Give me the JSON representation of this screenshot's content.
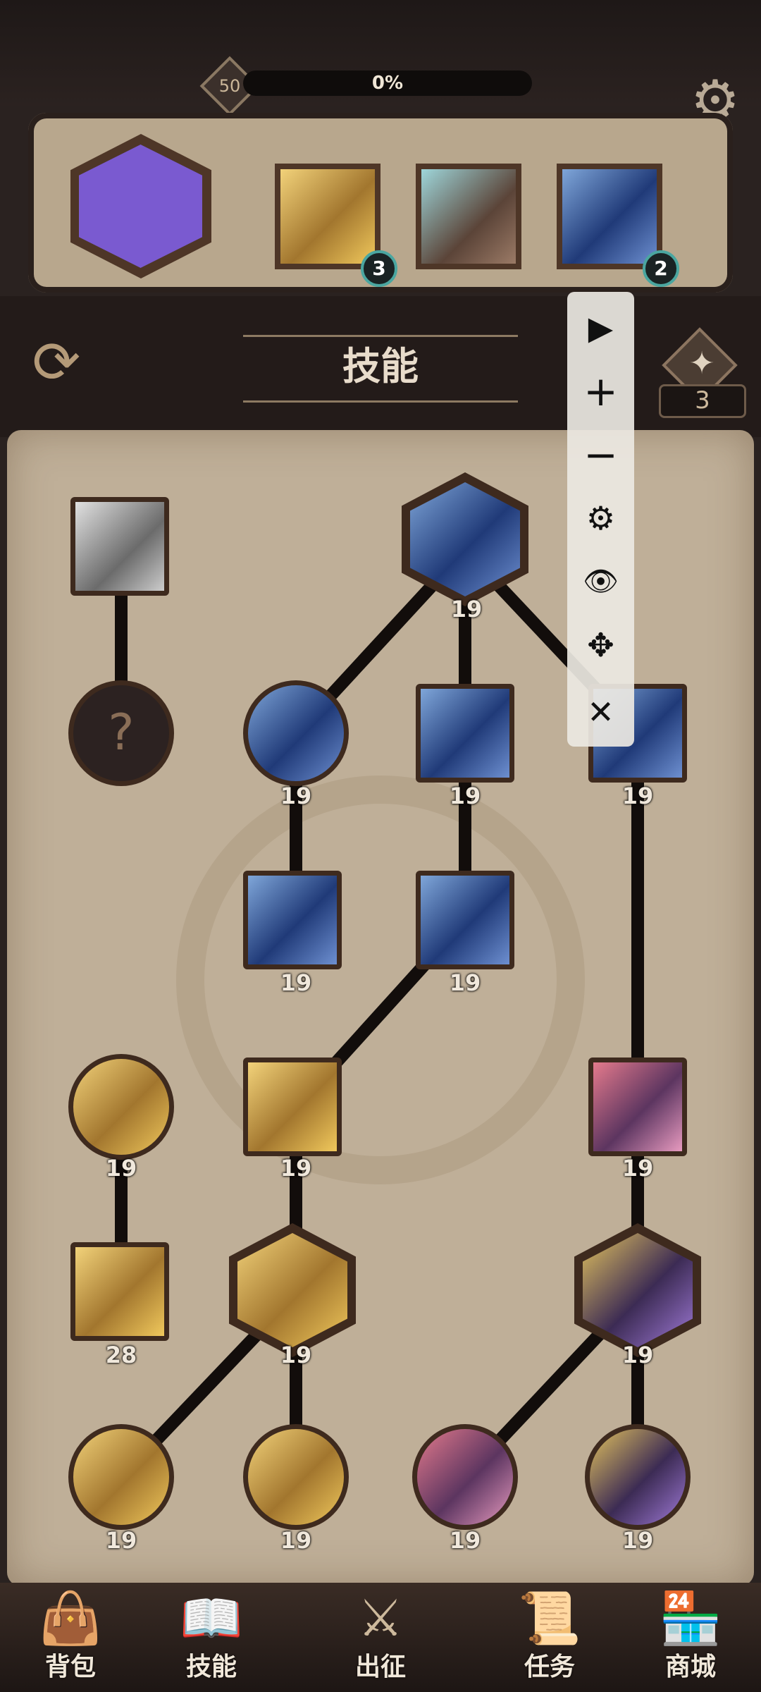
{
  "top_status": {
    "level": "50",
    "progress_text": "0%",
    "progress_fraction": 0.0,
    "settings_icon": "gear-icon"
  },
  "equipped_skills": [
    {
      "name_icon": "purple-crystal-skill-icon",
      "badge": ""
    },
    {
      "name_icon": "golden-blade-skill-icon",
      "badge": "3"
    },
    {
      "name_icon": "ice-rock-skill-icon",
      "badge": ""
    },
    {
      "name_icon": "ice-shard-skill-icon",
      "badge": "2"
    }
  ],
  "header": {
    "title": "技能",
    "skill_points": "3",
    "refresh_icon": "refresh-icon",
    "points_icon": "star-diamond-icon"
  },
  "control_panel": {
    "items": [
      {
        "icon": "play-icon",
        "glyph": "▶"
      },
      {
        "icon": "plus-icon",
        "glyph": "+"
      },
      {
        "icon": "minus-icon",
        "glyph": "−"
      },
      {
        "icon": "gear-icon",
        "glyph": "⚙"
      },
      {
        "icon": "eye-icon",
        "glyph": "👁"
      },
      {
        "icon": "move-icon",
        "glyph": "✥"
      },
      {
        "icon": "close-icon",
        "glyph": "✕"
      }
    ]
  },
  "skill_tree": {
    "locked_symbol": "?",
    "levels": {
      "n1": "19",
      "n2": "19",
      "n3": "19",
      "n4": "19",
      "n5": "19",
      "n6": "19",
      "n7": "19",
      "n8": "19",
      "n9": "19",
      "n10": "28",
      "n11": "19",
      "n12": "19",
      "n13": "19",
      "n14": "19",
      "n15": "19",
      "n16": "19"
    }
  },
  "bottom_nav": [
    {
      "label": "背包",
      "icon": "backpack-icon"
    },
    {
      "label": "技能",
      "icon": "skill-book-icon"
    },
    {
      "label": "出征",
      "icon": "sword-map-icon"
    },
    {
      "label": "任务",
      "icon": "scroll-icon"
    },
    {
      "label": "商城",
      "icon": "shop-icon"
    }
  ]
}
